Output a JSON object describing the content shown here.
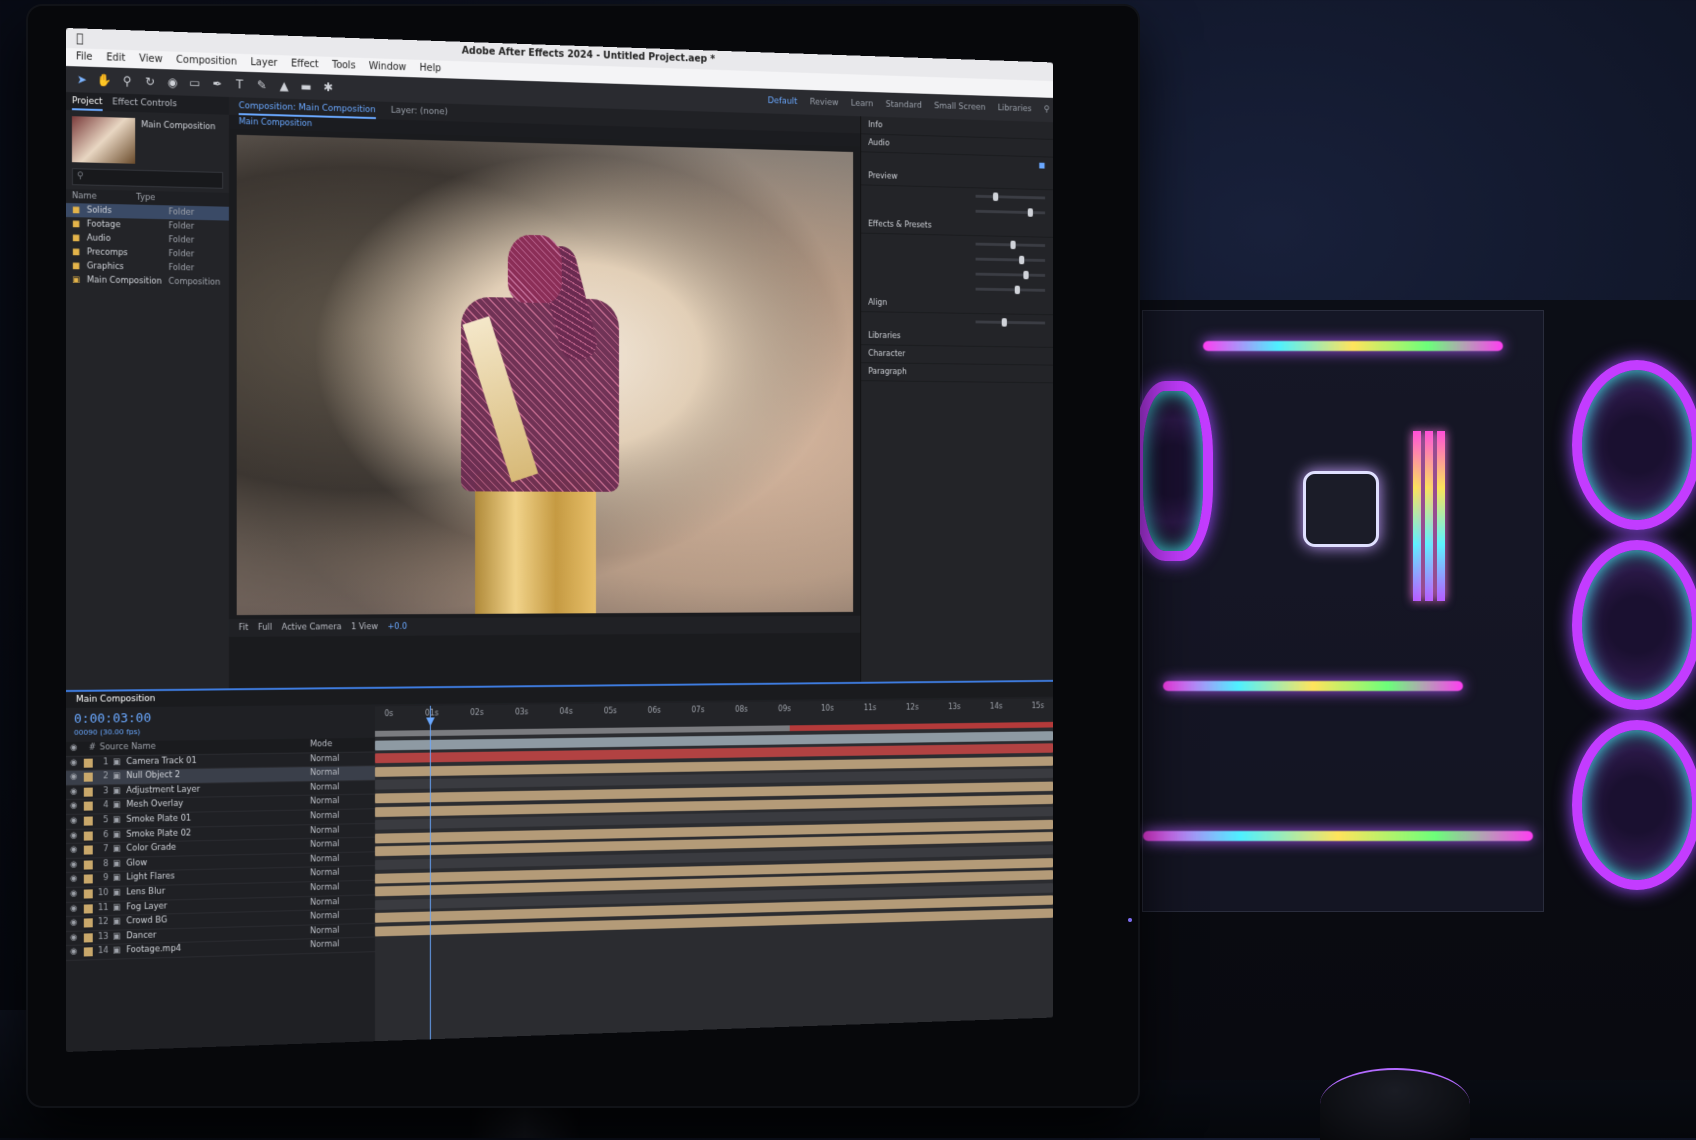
{
  "app": {
    "title": "Adobe After Effects 2024 - Untitled Project.aep *",
    "menus": [
      "File",
      "Edit",
      "View",
      "Composition",
      "Layer",
      "Effect",
      "Tools",
      "Window",
      "Help"
    ],
    "workspaces": [
      "Default",
      "Review",
      "Learn",
      "Standard",
      "Small Screen",
      "Libraries"
    ],
    "active_workspace": "Default"
  },
  "project_panel": {
    "tabs": [
      "Project",
      "Effect Controls"
    ],
    "active_tab": "Project",
    "search_placeholder": "",
    "columns": [
      "Name",
      "Type"
    ],
    "items": [
      {
        "name": "Solids",
        "type": "Folder"
      },
      {
        "name": "Footage",
        "type": "Folder"
      },
      {
        "name": "Audio",
        "type": "Folder"
      },
      {
        "name": "Precomps",
        "type": "Folder"
      },
      {
        "name": "Graphics",
        "type": "Folder"
      },
      {
        "name": "Main Composition",
        "type": "Composition"
      }
    ]
  },
  "composition": {
    "tabs": [
      "Composition: Main Composition",
      "Layer: (none)"
    ],
    "active_tab": "Composition: Main Composition",
    "sub_label": "Main Composition",
    "footer": {
      "zoom": "Fit",
      "resolution": "Full",
      "camera": "Active Camera",
      "views": "1 View",
      "timecode": "+0.0"
    }
  },
  "effects_panel": {
    "sections": [
      {
        "title": "Info"
      },
      {
        "title": "Audio"
      },
      {
        "title": "Preview"
      },
      {
        "title": "Effects & Presets"
      },
      {
        "title": "Align"
      },
      {
        "title": "Libraries"
      },
      {
        "title": "Character"
      },
      {
        "title": "Paragraph"
      }
    ]
  },
  "timeline": {
    "tab_label": "Main Composition",
    "timecode": "0:00:03:00",
    "timecode_sub": "00090 (30.00 fps)",
    "columns": [
      "#",
      "Source Name",
      "Mode"
    ],
    "ruler": [
      "0s",
      "01s",
      "02s",
      "03s",
      "04s",
      "05s",
      "06s",
      "07s",
      "08s",
      "09s",
      "10s",
      "11s",
      "12s",
      "13s",
      "14s",
      "15s"
    ],
    "layers": [
      {
        "num": "1",
        "name": "Camera Track 01",
        "mode": "Normal",
        "highlight": false
      },
      {
        "num": "2",
        "name": "Null Object 2",
        "mode": "Normal",
        "highlight": true
      },
      {
        "num": "3",
        "name": "Adjustment Layer",
        "mode": "Normal",
        "highlight": false
      },
      {
        "num": "4",
        "name": "Mesh Overlay",
        "mode": "Normal",
        "highlight": false
      },
      {
        "num": "5",
        "name": "Smoke Plate 01",
        "mode": "Normal",
        "highlight": false
      },
      {
        "num": "6",
        "name": "Smoke Plate 02",
        "mode": "Normal",
        "highlight": false
      },
      {
        "num": "7",
        "name": "Color Grade",
        "mode": "Normal",
        "highlight": false
      },
      {
        "num": "8",
        "name": "Glow",
        "mode": "Normal",
        "highlight": false
      },
      {
        "num": "9",
        "name": "Light Flares",
        "mode": "Normal",
        "highlight": false
      },
      {
        "num": "10",
        "name": "Lens Blur",
        "mode": "Normal",
        "highlight": false
      },
      {
        "num": "11",
        "name": "Fog Layer",
        "mode": "Normal",
        "highlight": false
      },
      {
        "num": "12",
        "name": "Crowd BG",
        "mode": "Normal",
        "highlight": false
      },
      {
        "num": "13",
        "name": "Dancer",
        "mode": "Normal",
        "highlight": false
      },
      {
        "num": "14",
        "name": "Footage.mp4",
        "mode": "Normal",
        "highlight": false
      }
    ],
    "tracks": [
      "gray",
      "red",
      "tan",
      "dark",
      "tan",
      "tan",
      "dark",
      "tan",
      "tan",
      "dark",
      "tan",
      "tan",
      "dark",
      "tan",
      "tan"
    ],
    "colors": {
      "accent": "#6aa8ff",
      "track_tan": "#b49b78",
      "track_red": "#b24242",
      "work_area": "#b43a3a"
    }
  }
}
